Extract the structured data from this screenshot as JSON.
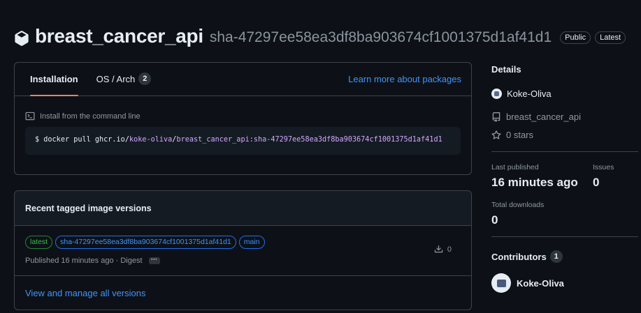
{
  "header": {
    "title": "breast_cancer_api",
    "sha": "sha-47297ee58ea3df8ba903674cf1001375d1af41d1",
    "badges": [
      "Public",
      "Latest"
    ]
  },
  "install": {
    "tabs": [
      {
        "label": "Installation"
      },
      {
        "label": "OS / Arch",
        "count": "2"
      }
    ],
    "learn_more": "Learn more about packages",
    "cmd_label": "Install from the command line",
    "command": {
      "prompt": "$",
      "base": "docker pull ghcr.io/",
      "owner": "koke-oliva",
      "sep": "/",
      "image": "breast_cancer_api:sha-47297ee58ea3df8ba903674cf1001375d1af41d1"
    }
  },
  "versions": {
    "title": "Recent tagged image versions",
    "row": {
      "tags": [
        "latest",
        "sha-47297ee58ea3df8ba903674cf1001375d1af41d1",
        "main"
      ],
      "published": "Published 16 minutes ago · Digest",
      "more": "···",
      "downloads": "0"
    },
    "view_all": "View and manage all versions"
  },
  "details": {
    "title": "Details",
    "owner": "Koke-Oliva",
    "repo": "breast_cancer_api",
    "stars": "0 stars",
    "last_published_label": "Last published",
    "last_published": "16 minutes ago",
    "issues_label": "Issues",
    "issues": "0",
    "downloads_label": "Total downloads",
    "downloads": "0"
  },
  "contributors": {
    "title": "Contributors",
    "count": "1",
    "items": [
      "Koke-Oliva"
    ]
  },
  "colors": {
    "background": "#0d1117",
    "link": "#4493f8",
    "tab_underline": "#f78166",
    "latest_tag": "#3fb950",
    "command_accent": "#d2a8ff"
  }
}
